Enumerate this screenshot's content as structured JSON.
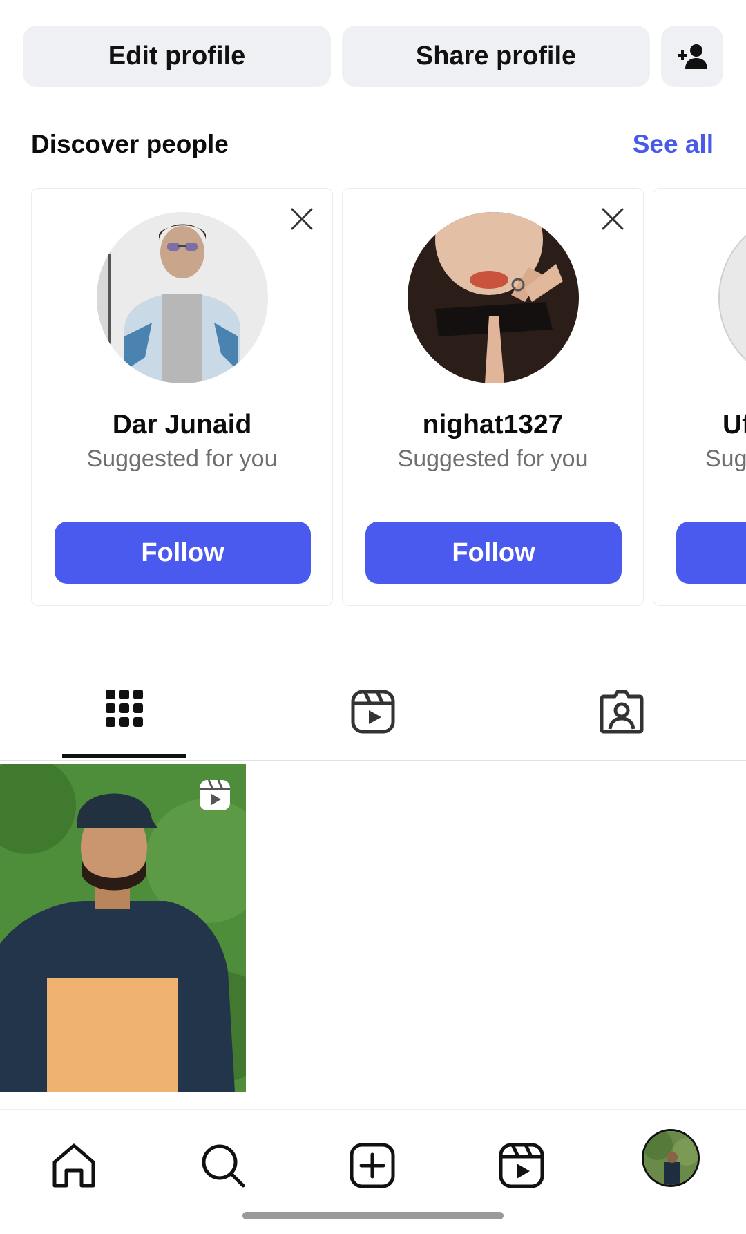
{
  "actions": {
    "edit_profile": "Edit profile",
    "share_profile": "Share profile",
    "add_person_icon": "person-add-icon"
  },
  "discover": {
    "title": "Discover people",
    "see_all": "See all",
    "cards": [
      {
        "name": "Dar Junaid",
        "subtitle": "Suggested for you",
        "button": "Follow"
      },
      {
        "name": "nighat1327",
        "subtitle": "Suggested for you",
        "button": "Follow"
      },
      {
        "name": "Uf",
        "subtitle": "Sug",
        "button": ""
      }
    ]
  },
  "tabs": [
    {
      "icon": "grid-icon",
      "active": true
    },
    {
      "icon": "reels-icon",
      "active": false
    },
    {
      "icon": "tagged-icon",
      "active": false
    }
  ],
  "bottom_nav": [
    "home-icon",
    "search-icon",
    "create-icon",
    "reels-icon",
    "profile-avatar"
  ],
  "colors": {
    "accent": "#4a5aef",
    "link": "#4a5ae8",
    "pill_bg": "#eff0f3"
  }
}
